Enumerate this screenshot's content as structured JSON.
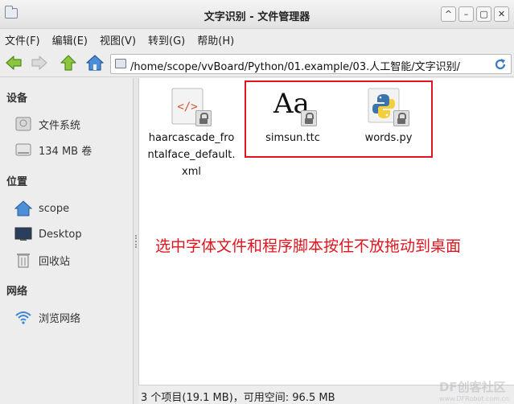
{
  "window": {
    "title": "文字识别 - 文件管理器",
    "btn_up": "^",
    "btn_min": "–",
    "btn_max": "▢",
    "btn_close": "✕"
  },
  "menu": [
    "文件(F)",
    "编辑(E)",
    "视图(V)",
    "转到(G)",
    "帮助(H)"
  ],
  "location": {
    "path": "/home/scope/vvBoard/Python/01.example/03.人工智能/文字识别/"
  },
  "sidebar": {
    "devices_heading": "设备",
    "devices": [
      "文件系统",
      "134 MB 卷"
    ],
    "places_heading": "位置",
    "places": [
      "scope",
      "Desktop",
      "回收站"
    ],
    "network_heading": "网络",
    "network": [
      "浏览网络"
    ]
  },
  "files": [
    {
      "name_line1": "haarcascade_fro",
      "name_line2": "ntalface_default.",
      "name_line3": "xml",
      "icon": "xml-code-icon",
      "locked": true
    },
    {
      "name": "simsun.ttc",
      "icon": "font-file-icon",
      "glyph": "Aa",
      "locked": true
    },
    {
      "name": "words.py",
      "icon": "python-file-icon",
      "locked": true
    }
  ],
  "annotation": "选中字体文件和程序脚本按住不放拖动到桌面",
  "status": "3 个项目(19.1 MB)，可用空间: 96.5 MB",
  "watermark": {
    "brand": "DF创客社区",
    "url": "www.DFRobot.com.cn"
  },
  "colors": {
    "highlight": "#e0141e",
    "accent": "#3a78c2"
  }
}
